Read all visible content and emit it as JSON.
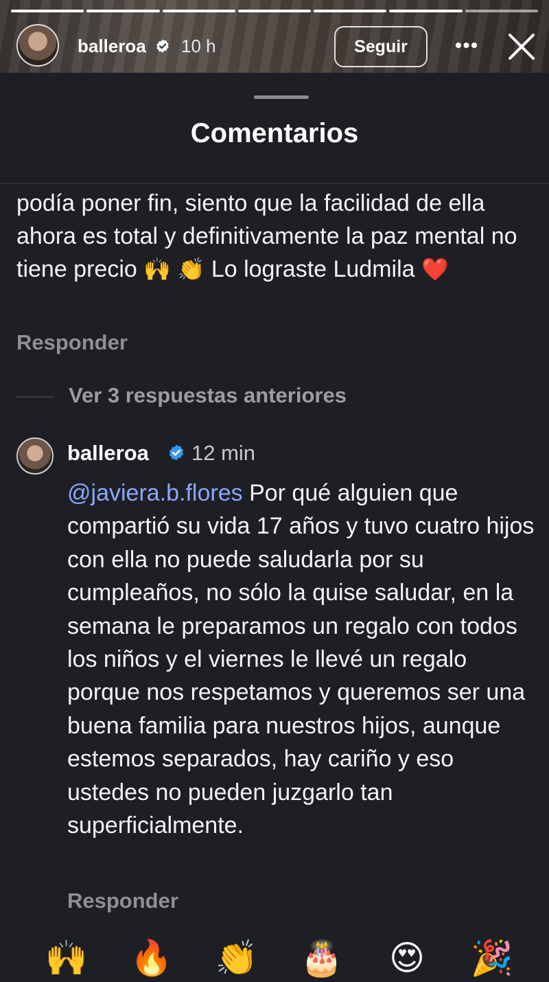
{
  "story": {
    "username": "balleroa",
    "time": "10 h",
    "follow_label": "Seguir",
    "progress_segments": 7,
    "progress_full": 6
  },
  "sheet": {
    "title": "Comentarios"
  },
  "comment1": {
    "text_part1": "podía poner fin, siento que la facilidad de ella ahora es total y definitivamente la paz mental no tiene precio ",
    "emoji_a": "🙌",
    "emoji_b": "👏",
    "text_part2": " Lo lograste Ludmila ",
    "emoji_c": "❤️",
    "reply_label": "Responder"
  },
  "view_replies": "Ver 3 respuestas anteriores",
  "comment2": {
    "username": "balleroa",
    "time": "12 min",
    "mention": "@javiera.b.flores",
    "text": " Por qué alguien que compartió su vida 17 años y tuvo cuatro hijos con ella no puede saludarla por su cumpleaños, no sólo la quise saludar, en la semana le preparamos un regalo con todos los niños y el viernes le llevé un regalo porque nos respetamos y queremos ser una buena familia para nuestros hijos, aunque estemos separados, hay cariño y eso ustedes no pueden juzgarlo tan superficialmente.",
    "reply_label": "Responder"
  },
  "quick_reactions": [
    "🙌",
    "🔥",
    "👏",
    "🎂",
    "😍",
    "🎉"
  ],
  "colors": {
    "mention": "#8aa7ff",
    "verified": "#3897f0",
    "sheet_bg": "#1d1f24"
  },
  "icons": [
    "verified-badge-icon",
    "more-options-icon",
    "close-icon"
  ]
}
